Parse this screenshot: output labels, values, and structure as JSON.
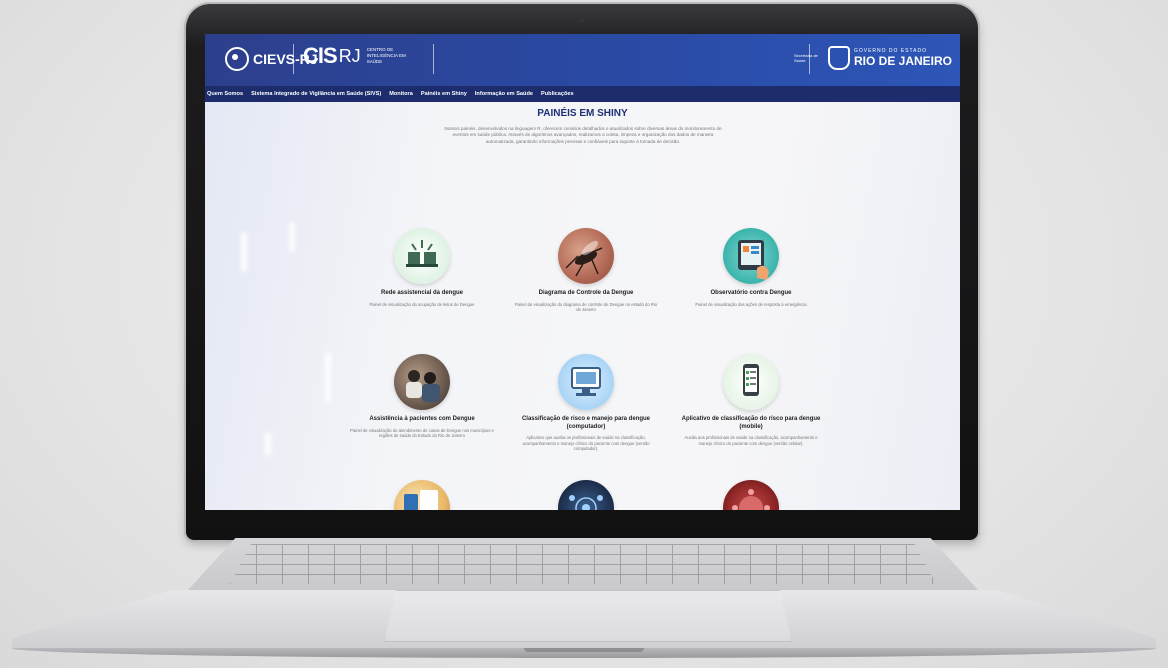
{
  "header": {
    "cievs_logo": "CIEVS-RJ",
    "cis_logo": "CIS",
    "cis_rj": "RJ",
    "cis_subtitle": "CENTRO DE INTELIGÊNCIA EM SAÚDE",
    "secretaria": "Secretaria de Saúde",
    "governo": "GOVERNO DO ESTADO",
    "rio": "RIO DE JANEIRO"
  },
  "nav": {
    "items": [
      "Quem Somos",
      "Sistema Integrado de Vigilância em Saúde (SIVS)",
      "Monitora",
      "Painéis em Shiny",
      "Informação em Saúde",
      "Publicações"
    ]
  },
  "main": {
    "title": "PAINÉIS EM SHINY",
    "intro": "Nossos painéis, desenvolvidos na linguagem R, oferecem cenários detalhados e atualizados sobre diversas áreas do monitoramento de eventos em saúde pública. Através de algoritmos avançados, realizamos a coleta, limpeza e organização dos dados de maneira automatizada, garantindo informações precisas e confiáveis para suporte à tomada de decisão.",
    "cards": [
      {
        "title": "Rede assistencial da dengue",
        "desc": "Painel de visualização da ocupação de leitos de Dengue"
      },
      {
        "title": "Diagrama de Controle da Dengue",
        "desc": "Painel de visualização do diagrama de controle de Dengue no estado do Rio de Janeiro"
      },
      {
        "title": "Observatório contra Dengue",
        "desc": "Painel de visualização das ações de resposta à emergência"
      },
      {
        "title": "Assistência à pacientes com Dengue",
        "desc": "Painel de visualização do atendimento de casos de Dengue nos municípios e regiões de saúde do Estado do Rio de Janeiro"
      },
      {
        "title": "Classificação de risco e manejo para dengue (computador)",
        "desc": "Aplicativo que auxilia os profissionais de saúde na classificação, acompanhamento e manejo clínico do paciente com dengue (versão computador)."
      },
      {
        "title": "Aplicativo de classificação do risco para dengue (mobile)",
        "desc": "Auxilia aos profissionais de saúde na classificação, acompanhamento e manejo clínico do paciente com dengue (versão celular)."
      }
    ]
  },
  "colors": {
    "header": "#2a4aa4",
    "nav": "#1c2c6c",
    "title": "#1f2f74"
  }
}
